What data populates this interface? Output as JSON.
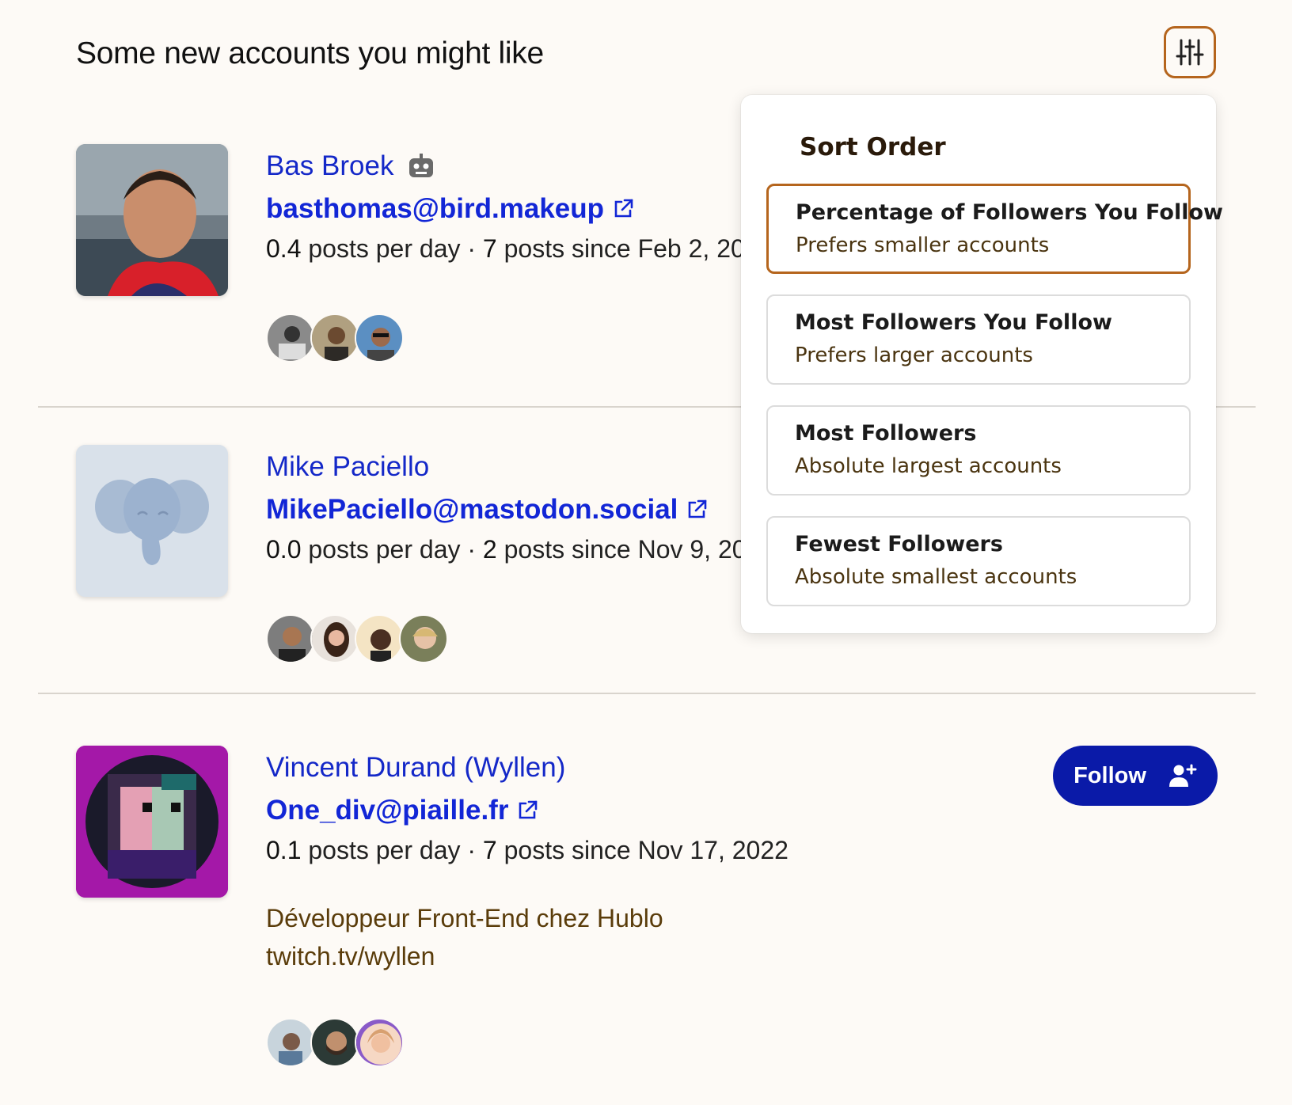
{
  "header": {
    "title": "Some new accounts you might like"
  },
  "sort_menu": {
    "title": "Sort Order",
    "options": [
      {
        "title": "Percentage of Followers You Follow",
        "subtitle": "Prefers smaller accounts",
        "selected": true
      },
      {
        "title": "Most Followers You Follow",
        "subtitle": "Prefers larger accounts",
        "selected": false
      },
      {
        "title": "Most Followers",
        "subtitle": "Absolute largest accounts",
        "selected": false
      },
      {
        "title": "Fewest Followers",
        "subtitle": "Absolute smallest accounts",
        "selected": false
      }
    ]
  },
  "accounts": [
    {
      "display_name": "Bas Broek",
      "handle": "basthomas@bird.makeup",
      "posts_per_day": "0.4",
      "posts_per_day_label": "posts per day",
      "post_count": "7",
      "since_label": "posts since Feb 2, 20",
      "bot_icon": "robot-icon"
    },
    {
      "display_name": "Mike Paciello",
      "handle": "MikePaciello@mastodon.social",
      "posts_per_day": "0.0",
      "posts_per_day_label": "posts per day",
      "post_count": "2",
      "since_label": "posts since Nov 9, 20"
    },
    {
      "display_name": "Vincent Durand (Wyllen)",
      "handle": "One_div@piaille.fr",
      "posts_per_day": "0.1",
      "posts_per_day_label": "posts per day",
      "post_count": "7",
      "since_label": "posts since Nov 17, 2022",
      "bio_line1": "Développeur Front-End chez Hublo",
      "bio_line2": "twitch.tv/wyllen",
      "follow_label": "Follow"
    }
  ],
  "colors": {
    "accent": "#b5651d",
    "link": "#1428c8",
    "follow_bg": "#0a1aa8",
    "background": "#fdfaf6"
  },
  "icons": [
    "sliders-icon",
    "robot-icon",
    "external-link-icon",
    "user-plus-icon",
    "mastodon-elephant-icon"
  ]
}
